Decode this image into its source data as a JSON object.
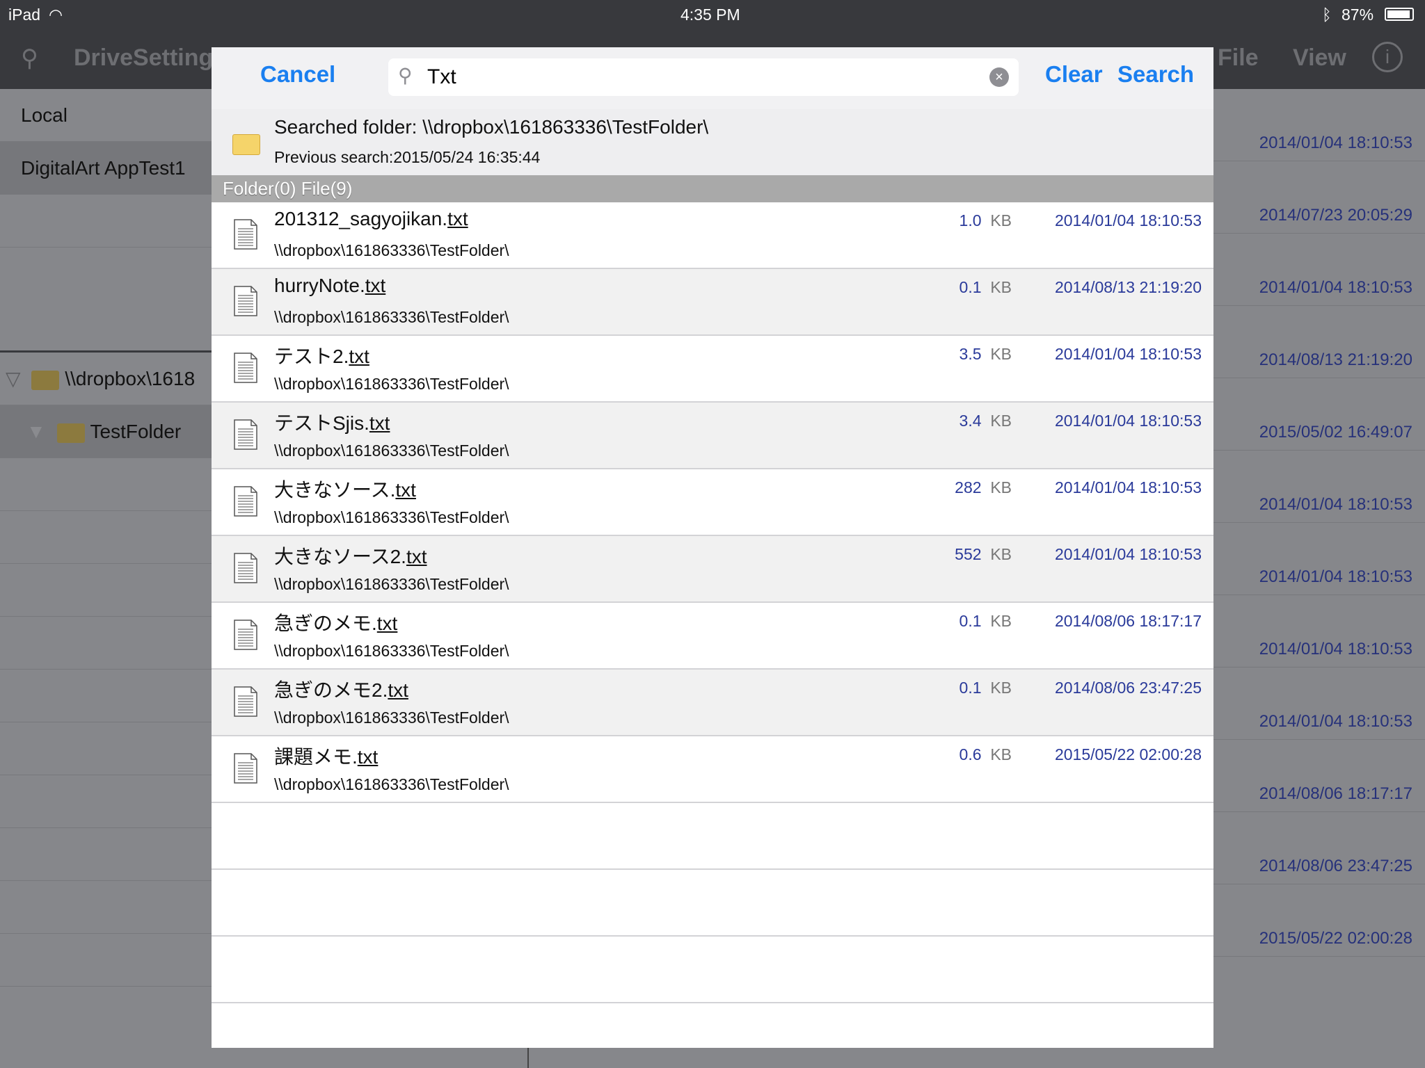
{
  "status": {
    "device": "iPad",
    "time": "4:35 PM",
    "battery": "87%"
  },
  "nav": {
    "title": "DriveSetting",
    "file": "File",
    "view": "View"
  },
  "sidebar": {
    "items": [
      {
        "label": "Local"
      },
      {
        "label": "DigitalArt AppTest1"
      }
    ],
    "tree": [
      {
        "label": "\\\\dropbox\\1618"
      },
      {
        "label": "TestFolder"
      }
    ]
  },
  "background_dates": [
    "2014/01/04 18:10:53",
    "2014/07/23 20:05:29",
    "2014/01/04 18:10:53",
    "2014/08/13 21:19:20",
    "2015/05/02 16:49:07",
    "2014/01/04 18:10:53",
    "2014/01/04 18:10:53",
    "2014/01/04 18:10:53",
    "2014/01/04 18:10:53",
    "2014/08/06 18:17:17",
    "2014/08/06 23:47:25",
    "2015/05/22 02:00:28"
  ],
  "search": {
    "cancel": "Cancel",
    "query": "Txt",
    "clear": "Clear",
    "search": "Search"
  },
  "info": {
    "searched_folder": "Searched folder: \\\\dropbox\\161863336\\TestFolder\\",
    "previous": "Previous search:2015/05/24 16:35:44"
  },
  "section": "Folder(0) File(9)",
  "colors": {
    "accent": "#1a7ff0",
    "date": "#2a3a9a",
    "navbar": "#38393d"
  },
  "results": [
    {
      "base": "201312_sagyojikan.",
      "ext": "txt",
      "path": "\\\\dropbox\\161863336\\TestFolder\\",
      "size": "1.0",
      "unit": "KB",
      "date": "2014/01/04 18:10:53"
    },
    {
      "base": "hurryNote.",
      "ext": "txt",
      "path": "\\\\dropbox\\161863336\\TestFolder\\",
      "size": "0.1",
      "unit": "KB",
      "date": "2014/08/13 21:19:20"
    },
    {
      "base": "テスト2.",
      "ext": "txt",
      "path": "\\\\dropbox\\161863336\\TestFolder\\",
      "size": "3.5",
      "unit": "KB",
      "date": "2014/01/04 18:10:53"
    },
    {
      "base": "テストSjis.",
      "ext": "txt",
      "path": "\\\\dropbox\\161863336\\TestFolder\\",
      "size": "3.4",
      "unit": "KB",
      "date": "2014/01/04 18:10:53"
    },
    {
      "base": "大きなソース.",
      "ext": "txt",
      "path": "\\\\dropbox\\161863336\\TestFolder\\",
      "size": "282",
      "unit": "KB",
      "date": "2014/01/04 18:10:53"
    },
    {
      "base": "大きなソース2.",
      "ext": "txt",
      "path": "\\\\dropbox\\161863336\\TestFolder\\",
      "size": "552",
      "unit": "KB",
      "date": "2014/01/04 18:10:53"
    },
    {
      "base": "急ぎのメモ.",
      "ext": "txt",
      "path": "\\\\dropbox\\161863336\\TestFolder\\",
      "size": "0.1",
      "unit": "KB",
      "date": "2014/08/06 18:17:17"
    },
    {
      "base": "急ぎのメモ2.",
      "ext": "txt",
      "path": "\\\\dropbox\\161863336\\TestFolder\\",
      "size": "0.1",
      "unit": "KB",
      "date": "2014/08/06 23:47:25"
    },
    {
      "base": "課題メモ.",
      "ext": "txt",
      "path": "\\\\dropbox\\161863336\\TestFolder\\",
      "size": "0.6",
      "unit": "KB",
      "date": "2015/05/22 02:00:28"
    }
  ]
}
